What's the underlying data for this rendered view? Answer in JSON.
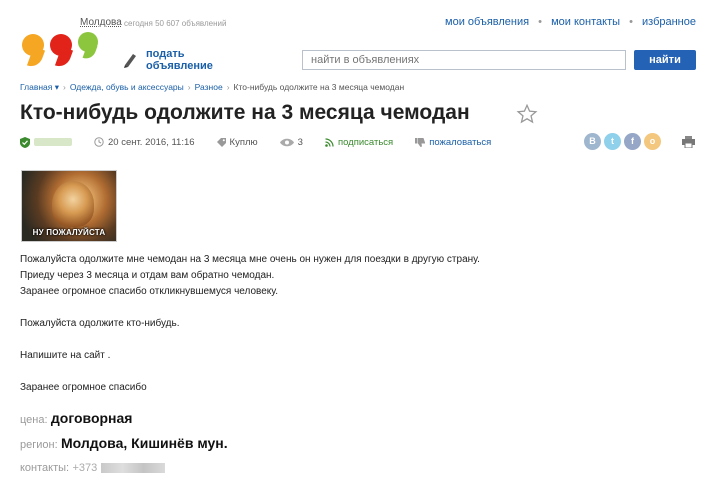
{
  "header": {
    "region": "Молдова",
    "ads_count": "сегодня 50 607 объявлений",
    "links": [
      "мои объявления",
      "мои контакты",
      "избранное"
    ]
  },
  "toolbar": {
    "post_label": "подать объявление",
    "search_placeholder": "найти в объявлениях",
    "search_button": "найти"
  },
  "breadcrumb": {
    "items": [
      "Главная ▾",
      "Одежда, обувь и аксессуары",
      "Разное",
      "Кто-нибудь одолжите на 3 месяца чемодан"
    ]
  },
  "ad": {
    "title": "Кто-нибудь одолжите на 3 месяца чемодан",
    "date": "20 сент. 2016, 11:16",
    "type": "Куплю",
    "views": "3",
    "subscribe": "подписаться",
    "report": "пожаловаться",
    "photo_caption": "НУ ПОЖАЛУЙСТА",
    "description": [
      " Пожалуйста одолжите мне чемодан на 3 месяца мне очень он нужен для поездки в другую страну.",
      "Приеду через 3 месяца и отдам вам обратно чемодан.",
      "Заранее огромное спасибо откликнувшемуся человеку.",
      "Пожалуйста одолжите кто-нибудь.",
      "Напишите на сайт .",
      "Заранее огромное спасибо"
    ],
    "price_label": "цена:",
    "price_value": "договорная",
    "region_label": "регион:",
    "region_value": "Молдова, Кишинёв мун.",
    "contacts_label": "контакты:",
    "contacts_value": "+373"
  },
  "social": [
    {
      "icon": "vk-icon",
      "glyph": "В",
      "color": "#9fb6cf"
    },
    {
      "icon": "twitter-icon",
      "glyph": "t",
      "color": "#8fd0ea"
    },
    {
      "icon": "facebook-icon",
      "glyph": "f",
      "color": "#95a6c6"
    },
    {
      "icon": "odnoklassniki-icon",
      "glyph": "о",
      "color": "#f3c77e"
    }
  ],
  "colors": {
    "link": "#1a5fa8",
    "search_button": "#2462b5",
    "logo": [
      "#f5a623",
      "#e2231a",
      "#8cc63f"
    ]
  }
}
